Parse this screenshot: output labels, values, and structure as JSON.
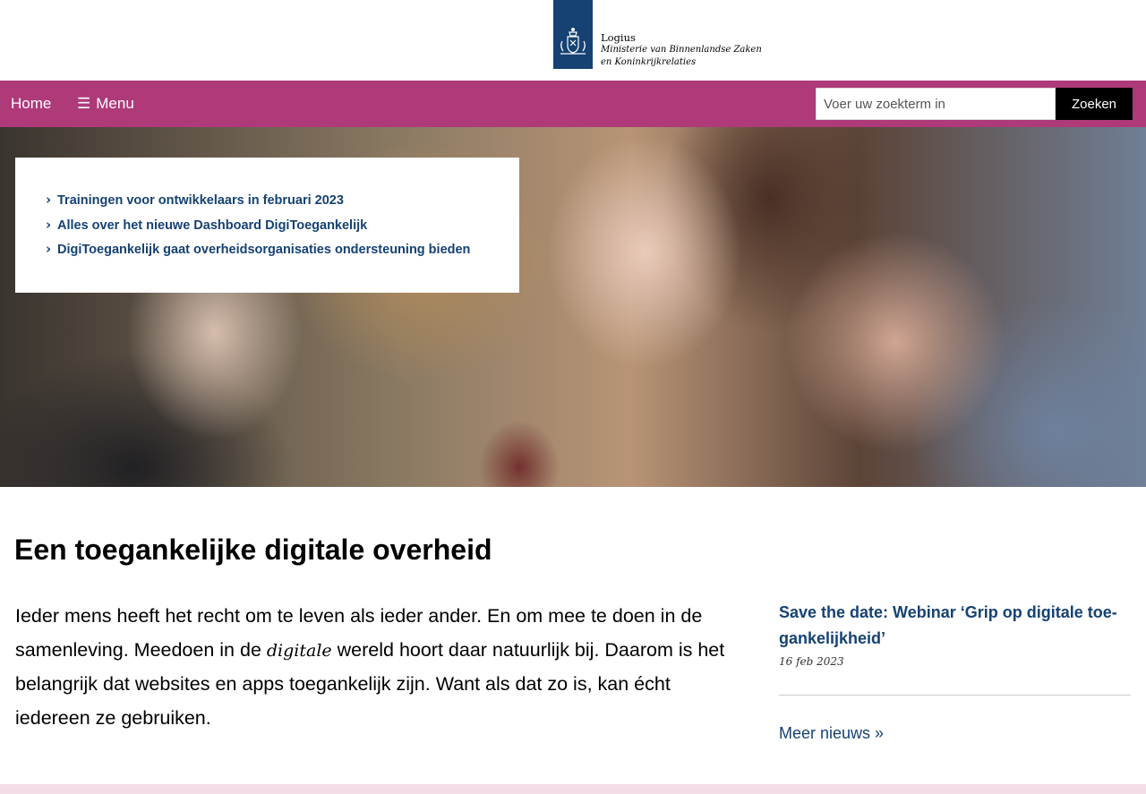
{
  "header": {
    "org_name": "Logius",
    "ministry": "Ministerie van Binnenlandse Zaken en Koninkrijkrelaties"
  },
  "nav": {
    "home_label": "Home",
    "menu_label": "Menu",
    "menu_icon": "☰",
    "search": {
      "placeholder": "Voer uw zoekterm in",
      "value": "",
      "button_label": "Zoeken"
    }
  },
  "hero": {
    "news_items": [
      {
        "label": "Trainingen voor ontwikkelaars in februari 2023"
      },
      {
        "label": "Alles over het nieuwe Dashboard DigiToegankelijk"
      },
      {
        "label": "DigiToegankelijk gaat overheidsorganisaties ondersteuning bieden"
      }
    ],
    "chevron": "›"
  },
  "main": {
    "title": "Een toegankelijke digitale overheid",
    "intro_before": "Ieder mens heeft het recht om te leven als ieder ander. En om mee te doen in de samenleving. Meedoen in de ",
    "intro_emphasis": "digitale",
    "intro_after": " wereld hoort daar natuurlijk bij. Daarom is het belangrijk dat websites en apps toegankelijk zijn. Want als dat zo is, kan écht iedereen ze gebruiken."
  },
  "sidebar": {
    "news_title": "Save the date: Webinar ‘Grip op digitale toe­gankelijkheid’",
    "news_date": "16 feb 2023",
    "more_label": "Meer nieuws »"
  },
  "colors": {
    "brand_blue": "#154273",
    "nav_magenta": "#ae3a7a",
    "footer_pink": "#f4dde9"
  }
}
